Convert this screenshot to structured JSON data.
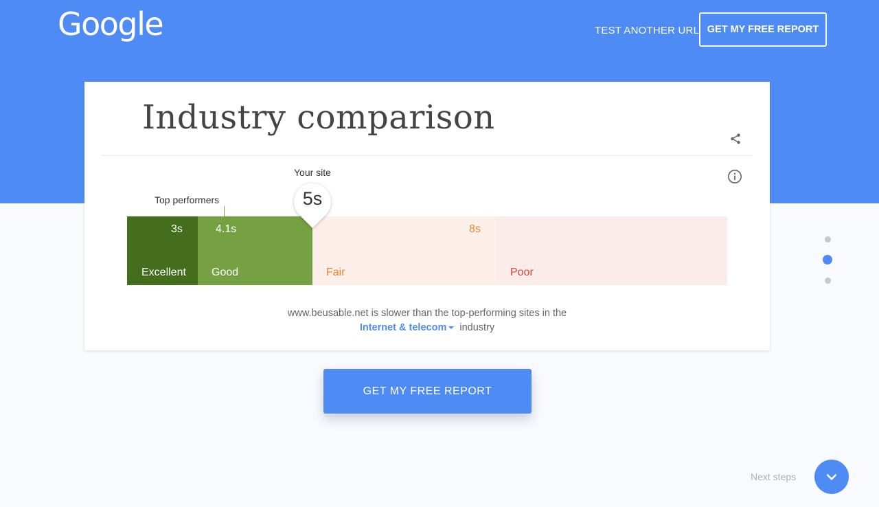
{
  "header": {
    "logo": "Google",
    "test_another_url": "TEST ANOTHER URL",
    "get_report": "GET MY FREE REPORT"
  },
  "card": {
    "title": "Industry comparison",
    "share_icon": "share-icon",
    "info_icon": "info-icon",
    "top_performers_label": "Top performers",
    "your_site_label": "Your site",
    "your_site_value": "5s",
    "segments": [
      {
        "label": "Excellent",
        "value": "3s",
        "color": "#446d1e"
      },
      {
        "label": "Good",
        "value": "4.1s",
        "color": "#76a143"
      },
      {
        "label": "Fair",
        "value": "8s",
        "color": "#fcefea",
        "text_color": "#e58a2e"
      },
      {
        "label": "Poor",
        "value": "",
        "color": "#fbebe9",
        "text_color": "#d9453a"
      }
    ],
    "summary": {
      "site": "www.beusable.net",
      "text": "is slower than the top-performing sites in the",
      "industry": "Internet & telecom",
      "suffix": "industry"
    }
  },
  "cta": "GET MY FREE REPORT",
  "pagination": {
    "total": 3,
    "active": 2
  },
  "next_steps": {
    "label": "Next steps",
    "icon": "chevron-down-icon"
  },
  "colors": {
    "brand": "#4f8bf5",
    "background": "#f9fafe"
  }
}
